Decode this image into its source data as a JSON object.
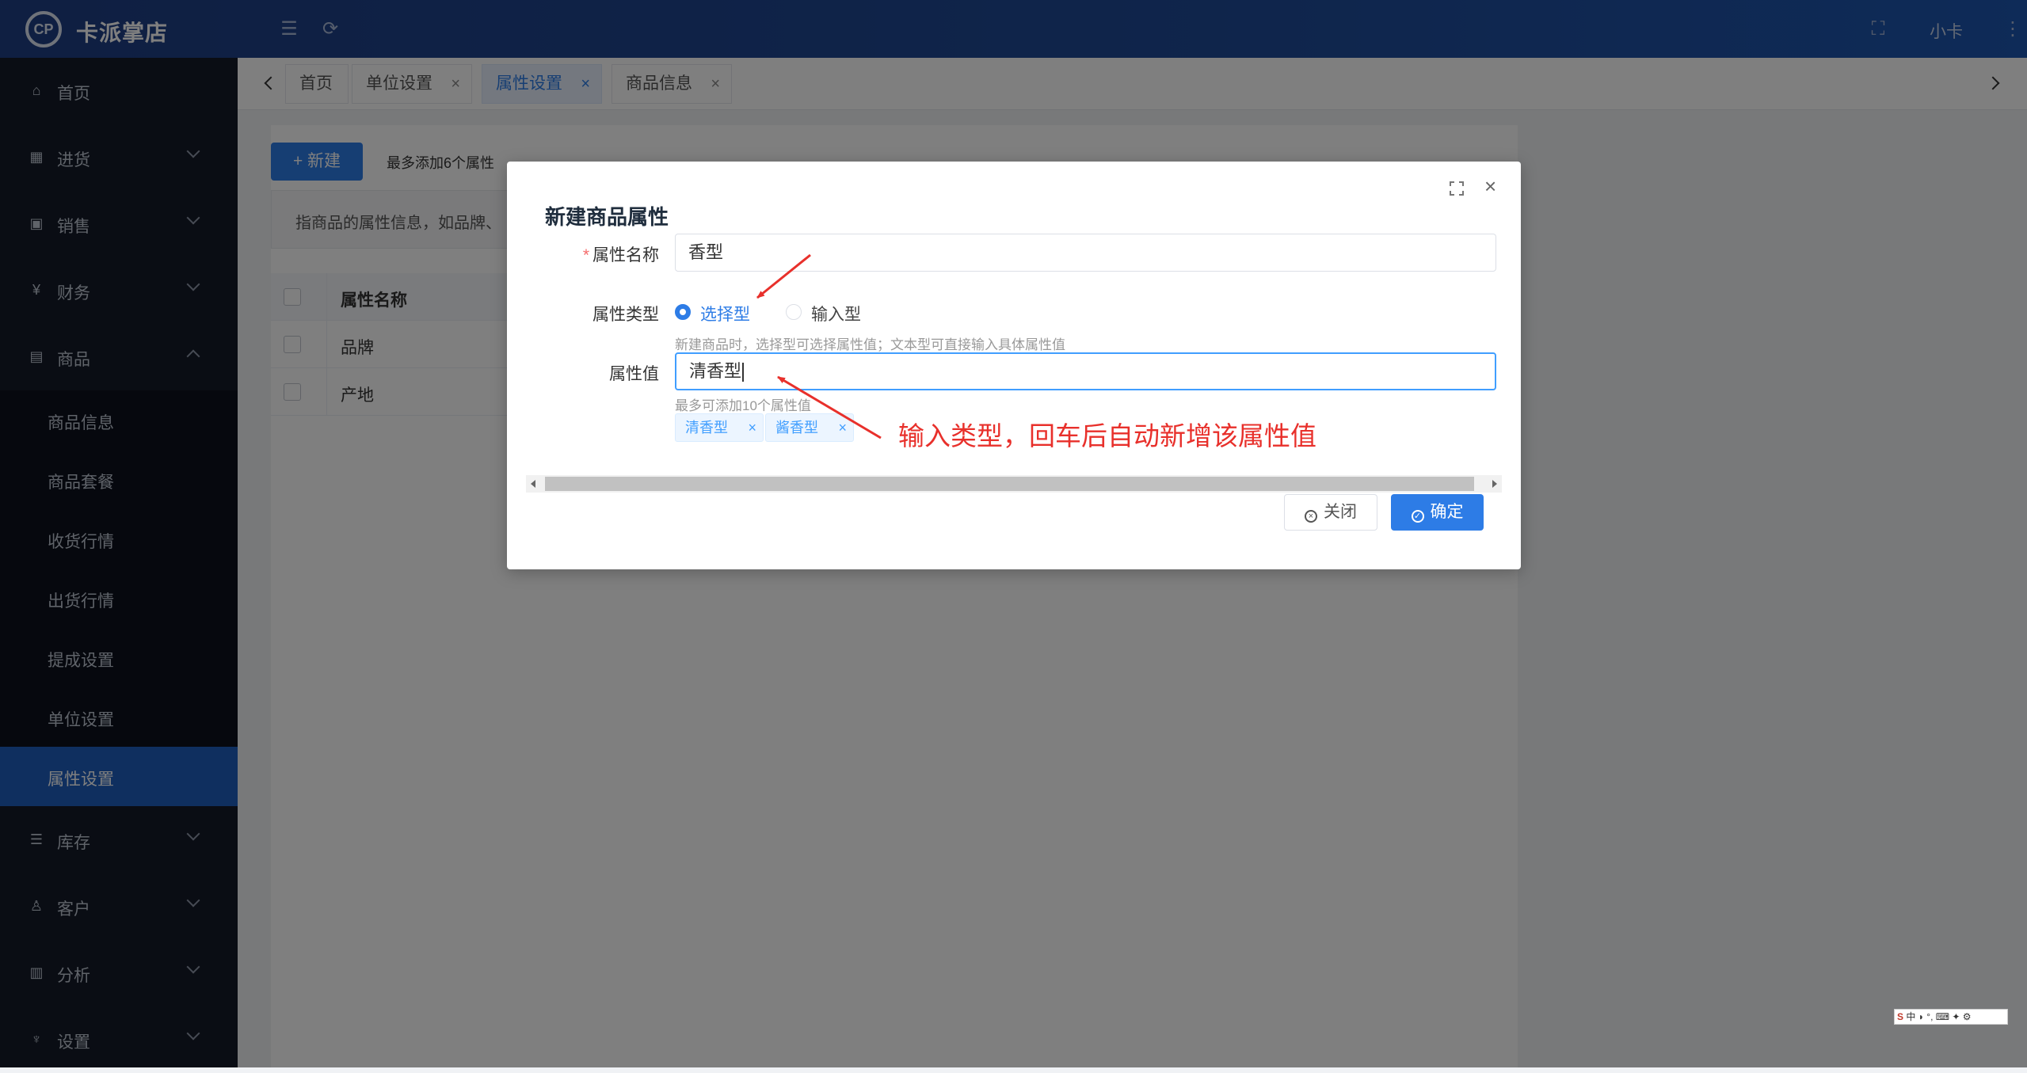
{
  "header": {
    "app_title": "卡派掌店",
    "user": "小卡",
    "icons": [
      "menu-fold-icon",
      "refresh-icon",
      "fullscreen-icon",
      "more-icon"
    ]
  },
  "sidebar": {
    "items": [
      {
        "label": "首页",
        "icon": "home-icon"
      },
      {
        "label": "进货",
        "icon": "purchase-icon"
      },
      {
        "label": "销售",
        "icon": "sales-icon"
      },
      {
        "label": "财务",
        "icon": "yen-icon"
      },
      {
        "label": "商品",
        "icon": "goods-icon"
      },
      {
        "label": "库存",
        "icon": "inventory-icon"
      },
      {
        "label": "客户",
        "icon": "customer-icon"
      },
      {
        "label": "分析",
        "icon": "chart-icon"
      },
      {
        "label": "设置",
        "icon": "settings-icon"
      }
    ],
    "sub_items": [
      "商品信息",
      "商品套餐",
      "收货行情",
      "出货行情",
      "提成设置",
      "单位设置",
      "属性设置"
    ],
    "active_sub": "属性设置",
    "active_color": "#1f5fbf"
  },
  "tabs": [
    {
      "label": "首页",
      "closable": false
    },
    {
      "label": "单位设置",
      "closable": true
    },
    {
      "label": "属性设置",
      "closable": true,
      "active": true
    },
    {
      "label": "商品信息",
      "closable": true
    }
  ],
  "page": {
    "new_button": "+ 新建",
    "max_hint": "最多添加6个属性",
    "info_text": "指商品的属性信息，如品牌、",
    "table": {
      "header": "属性名称",
      "rows": [
        "品牌",
        "产地"
      ]
    }
  },
  "dialog": {
    "title": "新建商品属性",
    "name_label": "属性名称",
    "name_value": "香型",
    "type_label": "属性类型",
    "type_options": [
      {
        "label": "选择型",
        "selected": true
      },
      {
        "label": "输入型",
        "selected": false
      }
    ],
    "type_hint": "新建商品时，选择型可选择属性值；文本型可直接输入具体属性值",
    "value_label": "属性值",
    "value_input": "清香型",
    "value_hint": "最多可添加10个属性值",
    "tags": [
      "清香型",
      "酱香型"
    ],
    "cancel_label": "关闭",
    "ok_label": "确定",
    "primary_color": "#2d7ce6"
  },
  "annotation": "输入类型，回车后自动新增该属性值",
  "ime_bar": "中 ◗ °, ⌨ ✦ ⚙"
}
